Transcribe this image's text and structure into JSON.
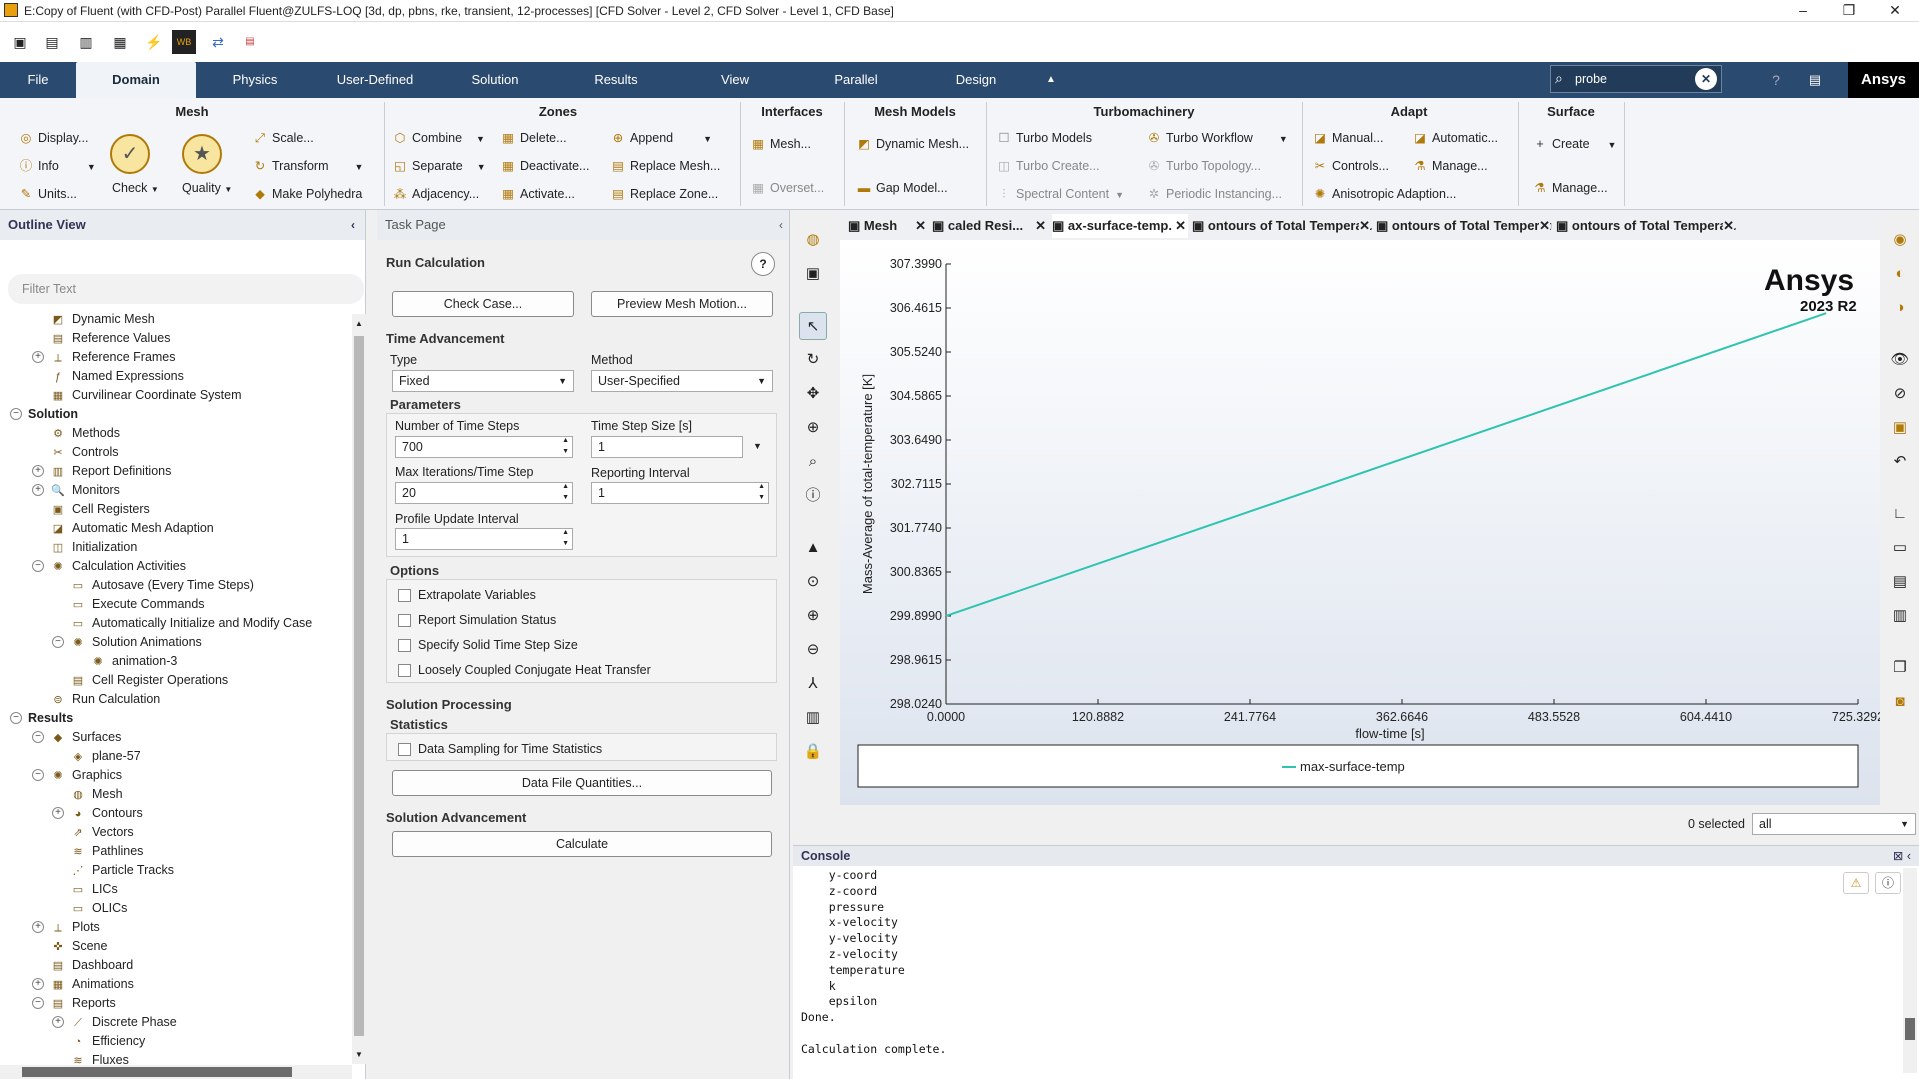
{
  "window": {
    "title": "E:Copy of Fluent (with CFD-Post) Parallel Fluent@ZULFS-LOQ  [3d, dp, pbns, rke, transient, 12-processes] [CFD Solver - Level 2, CFD Solver - Level 1, CFD Base]",
    "minimize": "–",
    "restore": "❐",
    "close": "✕"
  },
  "menu": {
    "tabs": [
      "File",
      "Domain",
      "Physics",
      "User-Defined",
      "Solution",
      "Results",
      "View",
      "Parallel",
      "Design"
    ],
    "active": "Domain",
    "search_value": "probe",
    "brand": "Ansys"
  },
  "ribbon": {
    "mesh": {
      "title": "Mesh",
      "display": "Display...",
      "info": "Info",
      "units": "Units...",
      "check": "Check",
      "quality": "Quality",
      "scale": "Scale...",
      "transform": "Transform",
      "make_polyhedra": "Make Polyhedra"
    },
    "zones": {
      "title": "Zones",
      "combine": "Combine",
      "separate": "Separate",
      "adjacency": "Adjacency...",
      "delete": "Delete...",
      "deactivate": "Deactivate...",
      "activate": "Activate...",
      "append": "Append",
      "replace_mesh": "Replace Mesh...",
      "replace_zone": "Replace Zone..."
    },
    "interfaces": {
      "title": "Interfaces",
      "mesh": "Mesh...",
      "overset": "Overset..."
    },
    "mesh_models": {
      "title": "Mesh Models",
      "dynamic_mesh": "Dynamic Mesh...",
      "gap_model": "Gap Model..."
    },
    "turbo": {
      "title": "Turbomachinery",
      "turbo_models": "Turbo Models",
      "turbo_create": "Turbo Create...",
      "spectral": "Spectral Content",
      "turbo_workflow": "Turbo Workflow",
      "turbo_topology": "Turbo Topology...",
      "periodic": "Periodic Instancing..."
    },
    "adapt": {
      "title": "Adapt",
      "manual": "Manual...",
      "controls": "Controls...",
      "anisotropic": "Anisotropic Adaption...",
      "automatic": "Automatic...",
      "manage": "Manage..."
    },
    "surface": {
      "title": "Surface",
      "create": "Create",
      "manage": "Manage..."
    }
  },
  "outline": {
    "title": "Outline View",
    "filter_placeholder": "Filter Text",
    "rows": [
      {
        "label": "Dynamic Mesh",
        "level": 2,
        "icon": "dynamic-mesh-icon",
        "glyph": "◩"
      },
      {
        "label": "Reference Values",
        "level": 2,
        "icon": "reference-values-icon",
        "glyph": "▤"
      },
      {
        "label": "Reference Frames",
        "level": 2,
        "icon": "reference-frames-icon",
        "glyph": "⟂",
        "toggle": "+"
      },
      {
        "label": "Named Expressions",
        "level": 2,
        "icon": "named-expressions-icon",
        "glyph": "ƒ"
      },
      {
        "label": "Curvilinear Coordinate System",
        "level": 2,
        "icon": "coordinate-system-icon",
        "glyph": "▦"
      },
      {
        "label": "Solution",
        "level": 1,
        "bold": true,
        "toggle": "−"
      },
      {
        "label": "Methods",
        "level": 2,
        "icon": "methods-icon",
        "glyph": "⚙"
      },
      {
        "label": "Controls",
        "level": 2,
        "icon": "controls-icon",
        "glyph": "✂"
      },
      {
        "label": "Report Definitions",
        "level": 2,
        "icon": "report-definitions-icon",
        "glyph": "▥",
        "toggle": "+"
      },
      {
        "label": "Monitors",
        "level": 2,
        "icon": "monitors-icon",
        "glyph": "🔍",
        "toggle": "+"
      },
      {
        "label": "Cell Registers",
        "level": 2,
        "icon": "cell-registers-icon",
        "glyph": "▣"
      },
      {
        "label": "Automatic Mesh Adaption",
        "level": 2,
        "icon": "mesh-adaption-icon",
        "glyph": "◪"
      },
      {
        "label": "Initialization",
        "level": 2,
        "icon": "initialization-icon",
        "glyph": "◫"
      },
      {
        "label": "Calculation Activities",
        "level": 2,
        "icon": "calculation-activities-icon",
        "glyph": "✺",
        "toggle": "−"
      },
      {
        "label": "Autosave (Every Time Steps)",
        "level": 3,
        "icon": "autosave-icon",
        "glyph": "▭"
      },
      {
        "label": "Execute Commands",
        "level": 3,
        "icon": "execute-commands-icon",
        "glyph": "▭"
      },
      {
        "label": "Automatically Initialize and Modify Case",
        "level": 3,
        "icon": "auto-initialize-icon",
        "glyph": "▭"
      },
      {
        "label": "Solution Animations",
        "level": 3,
        "icon": "solution-animations-icon",
        "glyph": "✺",
        "toggle": "−"
      },
      {
        "label": "animation-3",
        "level": 4,
        "icon": "animation-icon",
        "glyph": "✺"
      },
      {
        "label": "Cell Register Operations",
        "level": 3,
        "icon": "cell-register-ops-icon",
        "glyph": "▤"
      },
      {
        "label": "Run Calculation",
        "level": 2,
        "icon": "run-calculation-icon",
        "glyph": "⊜"
      },
      {
        "label": "Results",
        "level": 1,
        "bold": true,
        "toggle": "−"
      },
      {
        "label": "Surfaces",
        "level": 2,
        "icon": "surfaces-icon",
        "glyph": "◆",
        "toggle": "−"
      },
      {
        "label": "plane-57",
        "level": 3,
        "icon": "plane-icon",
        "glyph": "◈"
      },
      {
        "label": "Graphics",
        "level": 2,
        "icon": "graphics-icon",
        "glyph": "✺",
        "toggle": "−"
      },
      {
        "label": "Mesh",
        "level": 3,
        "icon": "mesh-icon",
        "glyph": "◍"
      },
      {
        "label": "Contours",
        "level": 3,
        "icon": "contours-icon",
        "glyph": "◕",
        "toggle": "+"
      },
      {
        "label": "Vectors",
        "level": 3,
        "icon": "vectors-icon",
        "glyph": "⇗"
      },
      {
        "label": "Pathlines",
        "level": 3,
        "icon": "pathlines-icon",
        "glyph": "≋"
      },
      {
        "label": "Particle Tracks",
        "level": 3,
        "icon": "particle-tracks-icon",
        "glyph": "⋰"
      },
      {
        "label": "LICs",
        "level": 3,
        "icon": "lics-icon",
        "glyph": "▭"
      },
      {
        "label": "OLICs",
        "level": 3,
        "icon": "olics-icon",
        "glyph": "▭"
      },
      {
        "label": "Plots",
        "level": 2,
        "icon": "plots-icon",
        "glyph": "⟂",
        "toggle": "+"
      },
      {
        "label": "Scene",
        "level": 2,
        "icon": "scene-icon",
        "glyph": "✜"
      },
      {
        "label": "Dashboard",
        "level": 2,
        "icon": "dashboard-icon",
        "glyph": "▤"
      },
      {
        "label": "Animations",
        "level": 2,
        "icon": "animations-icon",
        "glyph": "▦",
        "toggle": "+"
      },
      {
        "label": "Reports",
        "level": 2,
        "icon": "reports-icon",
        "glyph": "▤",
        "toggle": "−"
      },
      {
        "label": "Discrete Phase",
        "level": 3,
        "icon": "discrete-phase-icon",
        "glyph": "⟋",
        "toggle": "+"
      },
      {
        "label": "Efficiency",
        "level": 3,
        "icon": "efficiency-icon",
        "glyph": "◔"
      },
      {
        "label": "Fluxes",
        "level": 3,
        "icon": "fluxes-icon",
        "glyph": "≋"
      }
    ]
  },
  "task": {
    "header": "Task Page",
    "title": "Run Calculation",
    "check_case": "Check Case...",
    "preview_mesh": "Preview Mesh Motion...",
    "time_advancement": "Time Advancement",
    "type_label": "Type",
    "type_value": "Fixed",
    "method_label": "Method",
    "method_value": "User-Specified",
    "parameters": "Parameters",
    "num_steps_label": "Number of Time Steps",
    "num_steps": "700",
    "step_size_label": "Time Step Size [s]",
    "step_size": "1",
    "max_iter_label": "Max Iterations/Time Step",
    "max_iter": "20",
    "reporting_label": "Reporting Interval",
    "reporting": "1",
    "profile_label": "Profile Update Interval",
    "profile": "1",
    "options": "Options",
    "opt1": "Extrapolate Variables",
    "opt2": "Report Simulation Status",
    "opt3": "Specify Solid Time Step Size",
    "opt4": "Loosely Coupled Conjugate Heat Transfer",
    "solution_processing": "Solution Processing",
    "statistics": "Statistics",
    "data_sampling": "Data Sampling for Time Statistics",
    "data_file_quantities": "Data File Quantities...",
    "solution_advancement": "Solution Advancement",
    "calculate": "Calculate"
  },
  "tabs": [
    {
      "label": "Mesh",
      "selected": false
    },
    {
      "label": "caled Resi...",
      "selected": false
    },
    {
      "label": "ax-surface-temp.",
      "selected": true
    },
    {
      "label": "ontours of Total Temperatu",
      "selected": false
    },
    {
      "label": "ontours of Total Temperatu",
      "selected": false
    },
    {
      "label": "ontours of Total Temperatu",
      "selected": false
    }
  ],
  "graphics": {
    "brand": "Ansys",
    "version": "2023 R2",
    "selected_count": "0 selected",
    "selection_filter": "all"
  },
  "chart_data": {
    "type": "line",
    "xlabel": "flow-time [s]",
    "ylabel": "Mass-Average of total-temperature [K]",
    "xlim": [
      0,
      725.3292
    ],
    "ylim": [
      298.024,
      307.399
    ],
    "xticks": [
      "0.0000",
      "120.8882",
      "241.7764",
      "362.6646",
      "483.5528",
      "604.4410",
      "725.3292"
    ],
    "yticks": [
      "307.3990",
      "306.4615",
      "305.5240",
      "304.5865",
      "303.6490",
      "302.7115",
      "301.7740",
      "300.8365",
      "299.8990",
      "298.9615",
      "298.0240"
    ],
    "series": [
      {
        "name": "max-surface-temp",
        "color": "#2ec4b0",
        "x": [
          0,
          700
        ],
        "y": [
          299.9,
          306.35
        ]
      }
    ],
    "legend": "bottom"
  },
  "console": {
    "title": "Console",
    "lines": [
      "    y-coord",
      "    z-coord",
      "    pressure",
      "    x-velocity",
      "    y-velocity",
      "    z-velocity",
      "    temperature",
      "    k",
      "    epsilon",
      "Done.",
      "",
      "Calculation complete."
    ]
  }
}
